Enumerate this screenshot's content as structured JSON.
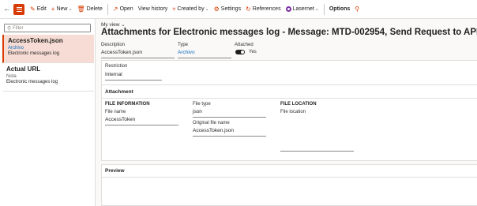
{
  "toolbar": {
    "items": [
      {
        "label": "Edit",
        "icon": "pencil-icon"
      },
      {
        "label": "New",
        "icon": "plus-icon",
        "dropdown": true
      },
      {
        "label": "Delete",
        "icon": "trash-icon"
      },
      {
        "label": "Open",
        "icon": "open-icon"
      },
      {
        "label": "View history",
        "icon": ""
      },
      {
        "label": "Created by",
        "icon": "filter-icon",
        "dropdown": true
      },
      {
        "label": "Settings",
        "icon": "gear-icon"
      },
      {
        "label": "References",
        "icon": "references-icon"
      },
      {
        "label": "Lasernet",
        "icon": "lasernet-icon",
        "dropdown": true
      },
      {
        "label": "Options",
        "icon": ""
      }
    ],
    "accent_color": "#d83b01"
  },
  "left_panel": {
    "filter_placeholder": "Filter",
    "items": [
      {
        "title": "AccessToken.json",
        "type": "Archivo",
        "description": "Electronic messages log",
        "selected": true
      },
      {
        "title": "Actual URL",
        "type": "Nota",
        "description": "Electronic messages log",
        "selected": false
      }
    ]
  },
  "main": {
    "my_view": "My view",
    "title": "Attachments for Electronic messages log - Message: MTD-002954, Send Request to API",
    "description_label": "Description",
    "description_value": "AccessToken.json",
    "type_label": "Type",
    "type_value": "Archivo",
    "attached_label": "Attached",
    "attached_value": "Yes",
    "restriction_label": "Restriction",
    "restriction_value": "Internal",
    "attachment_section": "Attachment",
    "file_information_header": "FILE INFORMATION",
    "file_name_label": "File name",
    "file_name_value": "AccessToken",
    "file_type_label": "File type",
    "file_type_value": "json",
    "original_file_name_label": "Original file name",
    "original_file_name_value": "AccessToken.json",
    "file_location_header": "FILE LOCATION",
    "file_location_label": "File location",
    "file_location_value": "",
    "preview_section": "Preview"
  }
}
